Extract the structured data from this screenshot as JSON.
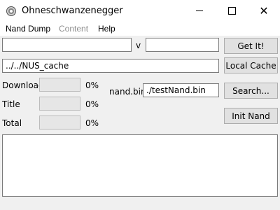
{
  "window": {
    "title": "Ohneschwanzenegger",
    "icon": "app-disc-icon"
  },
  "menu": {
    "items": [
      {
        "label": "Nand Dump",
        "enabled": true
      },
      {
        "label": "Content",
        "enabled": false
      },
      {
        "label": "Help",
        "enabled": true
      }
    ]
  },
  "download": {
    "title_id_value": "",
    "version_label": "v",
    "version_value": "",
    "get_button": "Get It!"
  },
  "cache": {
    "path_value": "../../NUS_cache",
    "local_cache_button": "Local Cache"
  },
  "progress": {
    "rows": [
      {
        "label": "Download",
        "percent_text": "0%",
        "fraction": 0
      },
      {
        "label": "Title",
        "percent_text": "0%",
        "fraction": 0
      },
      {
        "label": "Total",
        "percent_text": "0%",
        "fraction": 0
      }
    ]
  },
  "nand": {
    "label": "nand.bin",
    "path_value": "./testNand.bin",
    "search_button": "Search...",
    "init_button": "Init Nand"
  },
  "log": {
    "text": ""
  }
}
